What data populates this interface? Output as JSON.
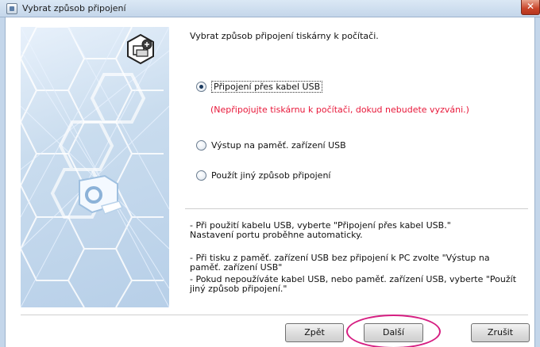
{
  "window": {
    "title": "Vybrat způsob připojení",
    "close_symbol": "✕"
  },
  "main": {
    "heading": "Vybrat způsob připojení tiskárny k počítači.",
    "options": [
      {
        "label": "Připojení přes kabel USB",
        "selected": true
      },
      {
        "label": "Výstup na paměť. zařízení USB",
        "selected": false
      },
      {
        "label": "Použít jiný způsob připojení",
        "selected": false
      }
    ],
    "warning": "(Nepřipojujte tiskárnu k počítači, dokud nebudete vyzváni.)",
    "notes": {
      "usb_line1": "- Při použití kabelu USB, vyberte \"Připojení přes kabel USB.\"",
      "usb_line2": "Nastavení portu proběhne automaticky.",
      "mem_line1": "- Při tisku z paměť. zařízení USB bez připojení k PC zvolte \"Výstup na",
      "mem_line2": "paměť. zařízení USB\"",
      "other_line1": "- Pokud nepoužíváte kabel USB, nebo paměť. zařízení USB, vyberte \"Použít",
      "other_line2": "jiný způsob připojení.\""
    }
  },
  "buttons": {
    "back": "Zpět",
    "next": "Další",
    "cancel": "Zrušit"
  },
  "colors": {
    "warning": "#e8183a",
    "highlight": "#d61f82"
  },
  "icons": [
    "app-icon",
    "close-icon",
    "printer-network-icon",
    "printer-icon"
  ]
}
